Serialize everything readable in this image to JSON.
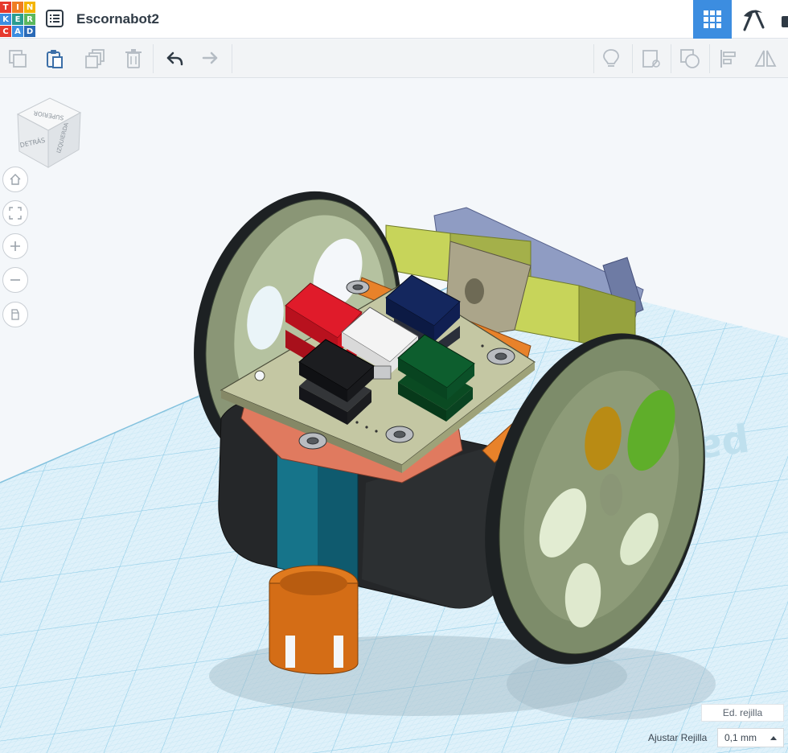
{
  "app": {
    "logo_letters": [
      "T",
      "I",
      "N",
      "K",
      "E",
      "R",
      "C",
      "A",
      "D"
    ],
    "logo_colors": [
      "#e63a2e",
      "#ef7d22",
      "#f4b400",
      "#3c8de0",
      "#2a9d8f",
      "#5bb85d",
      "#e63a2e",
      "#3c8de0",
      "#2a6ab7"
    ],
    "title": "Escornabot2"
  },
  "header": {
    "views": [
      {
        "name": "3d-design-view",
        "icon": "grid-icon",
        "active": true
      },
      {
        "name": "build-view",
        "icon": "pickaxe-icon",
        "active": false
      }
    ]
  },
  "toolbar": {
    "left_icons": [
      "copy-icon",
      "paste-icon",
      "duplicate-icon",
      "delete-icon",
      "undo-icon",
      "redo-icon"
    ],
    "right_icons": [
      "lightbulb-icon",
      "note-icon",
      "group-icon",
      "align-icon",
      "mirror-icon"
    ]
  },
  "viewcube": {
    "top": "SUPERIOR",
    "front": "DETRÁS",
    "side": "IZQUIERDA"
  },
  "nav": [
    "home-icon",
    "fit-icon",
    "zoom-in-icon",
    "zoom-out-icon",
    "perspective-icon"
  ],
  "grid": {
    "edit_label": "Ed. rejilla",
    "snap_label": "Ajustar Rejilla",
    "snap_value": "0,1 mm"
  },
  "colors": {
    "accent": "#3c8de0",
    "grid_line": "#9cd3ea",
    "grid_fill": "#dff1fa",
    "wheel": "#7d8c6a",
    "button_red": "#e01b2a",
    "button_blue": "#14275e",
    "button_white": "#f4f4f4",
    "button_black": "#1c1d20",
    "button_green": "#0d5e2e"
  }
}
